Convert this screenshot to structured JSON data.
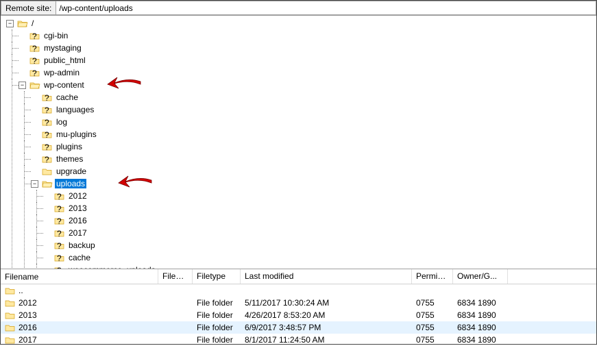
{
  "addressBar": {
    "label": "Remote site:",
    "path": "/wp-content/uploads"
  },
  "tree": {
    "root": "/",
    "rootChildren": [
      {
        "name": "cgi-bin",
        "icon": "q"
      },
      {
        "name": "mystaging",
        "icon": "q"
      },
      {
        "name": "public_html",
        "icon": "q"
      },
      {
        "name": "wp-admin",
        "icon": "q"
      }
    ],
    "wpcontent": {
      "name": "wp-content",
      "children": [
        {
          "name": "cache",
          "icon": "q"
        },
        {
          "name": "languages",
          "icon": "q"
        },
        {
          "name": "log",
          "icon": "q"
        },
        {
          "name": "mu-plugins",
          "icon": "q"
        },
        {
          "name": "plugins",
          "icon": "q"
        },
        {
          "name": "themes",
          "icon": "q"
        },
        {
          "name": "upgrade",
          "icon": "folder"
        }
      ]
    },
    "uploads": {
      "name": "uploads",
      "children": [
        {
          "name": "2012",
          "icon": "q"
        },
        {
          "name": "2013",
          "icon": "q"
        },
        {
          "name": "2016",
          "icon": "q"
        },
        {
          "name": "2017",
          "icon": "q"
        },
        {
          "name": "backup",
          "icon": "q"
        },
        {
          "name": "cache",
          "icon": "q"
        },
        {
          "name": "woocommerce_uploads",
          "icon": "q"
        }
      ]
    }
  },
  "list": {
    "headers": {
      "name": "Filename",
      "size": "Filesize",
      "type": "Filetype",
      "modified": "Last modified",
      "perm": "Permissi...",
      "owner": "Owner/G..."
    },
    "parent": "..",
    "rows": [
      {
        "name": "2012",
        "size": "",
        "type": "File folder",
        "modified": "5/11/2017 10:30:24 AM",
        "perm": "0755",
        "owner": "6834 1890"
      },
      {
        "name": "2013",
        "size": "",
        "type": "File folder",
        "modified": "4/26/2017 8:53:20 AM",
        "perm": "0755",
        "owner": "6834 1890"
      },
      {
        "name": "2016",
        "size": "",
        "type": "File folder",
        "modified": "6/9/2017 3:48:57 PM",
        "perm": "0755",
        "owner": "6834 1890",
        "selected": true
      },
      {
        "name": "2017",
        "size": "",
        "type": "File folder",
        "modified": "8/1/2017 11:24:50 AM",
        "perm": "0755",
        "owner": "6834 1890"
      }
    ]
  }
}
